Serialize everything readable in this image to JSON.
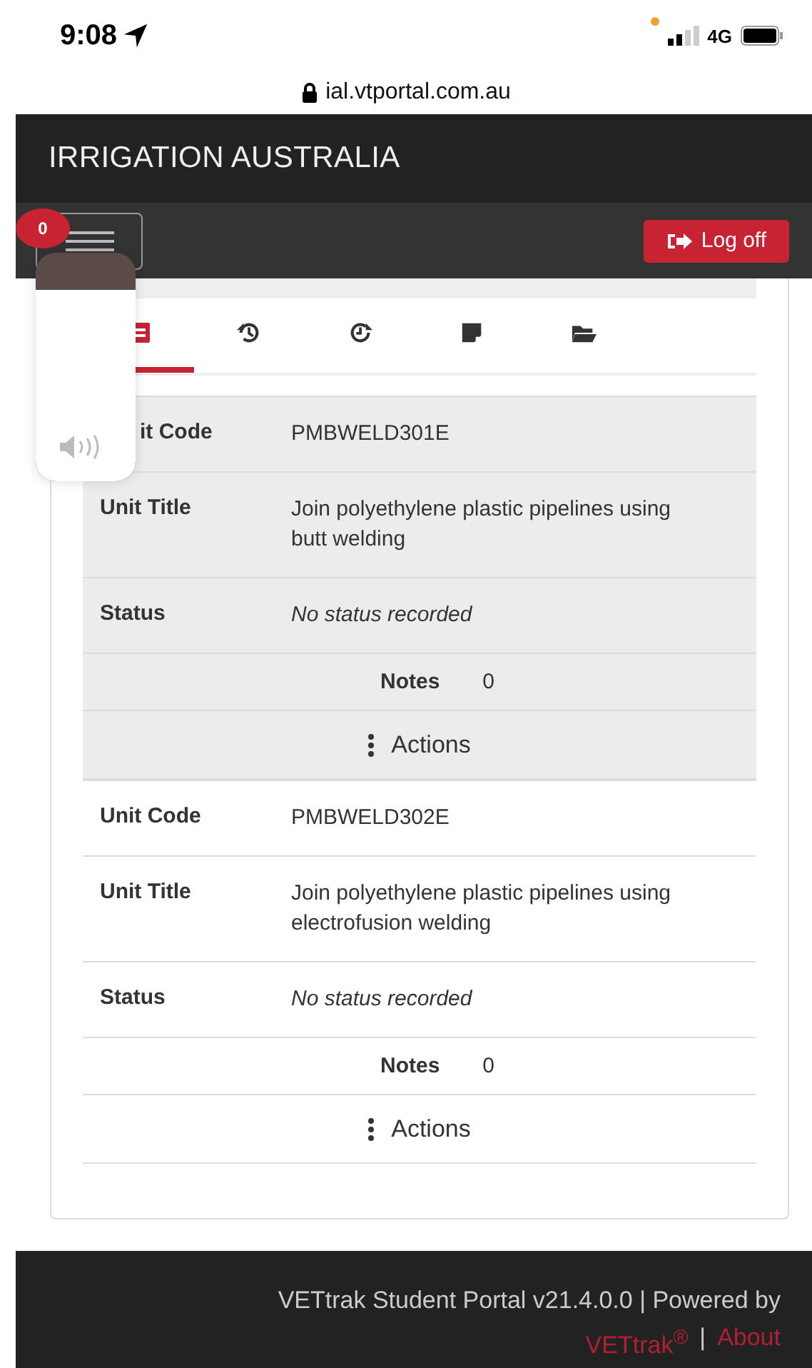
{
  "status_bar": {
    "time": "9:08",
    "network": "4G"
  },
  "address_bar": {
    "url": "ial.vtportal.com.au"
  },
  "header": {
    "title": "IRRIGATION AUSTRALIA"
  },
  "nav": {
    "badge": "0",
    "logoff": "Log off"
  },
  "tabs": [
    {
      "selected": true
    },
    {
      "selected": false
    },
    {
      "selected": false
    },
    {
      "selected": false
    },
    {
      "selected": false
    }
  ],
  "units": [
    {
      "highlighted": true,
      "rows": [
        {
          "label": "it Code",
          "value": "PMBWELD301E",
          "italic": false
        },
        {
          "label": "Unit Title",
          "value": "Join polyethylene plastic pipelines using butt welding",
          "italic": false
        },
        {
          "label": "Status",
          "value": "No status recorded",
          "italic": true
        }
      ],
      "notes_label": "Notes",
      "notes_count": "0",
      "actions": "Actions"
    },
    {
      "highlighted": false,
      "rows": [
        {
          "label": "Unit Code",
          "value": "PMBWELD302E",
          "italic": false
        },
        {
          "label": "Unit Title",
          "value": "Join polyethylene plastic pipelines using electrofusion welding",
          "italic": false
        },
        {
          "label": "Status",
          "value": "No status recorded",
          "italic": true
        }
      ],
      "notes_label": "Notes",
      "notes_count": "0",
      "actions": "Actions"
    }
  ],
  "volume_popup": {
    "level": 0.84
  },
  "footer": {
    "text": "VETtrak Student Portal v21.4.0.0 | Powered by",
    "link": "VETtrak$^{®}$",
    "separator": "|",
    "about": "About"
  }
}
